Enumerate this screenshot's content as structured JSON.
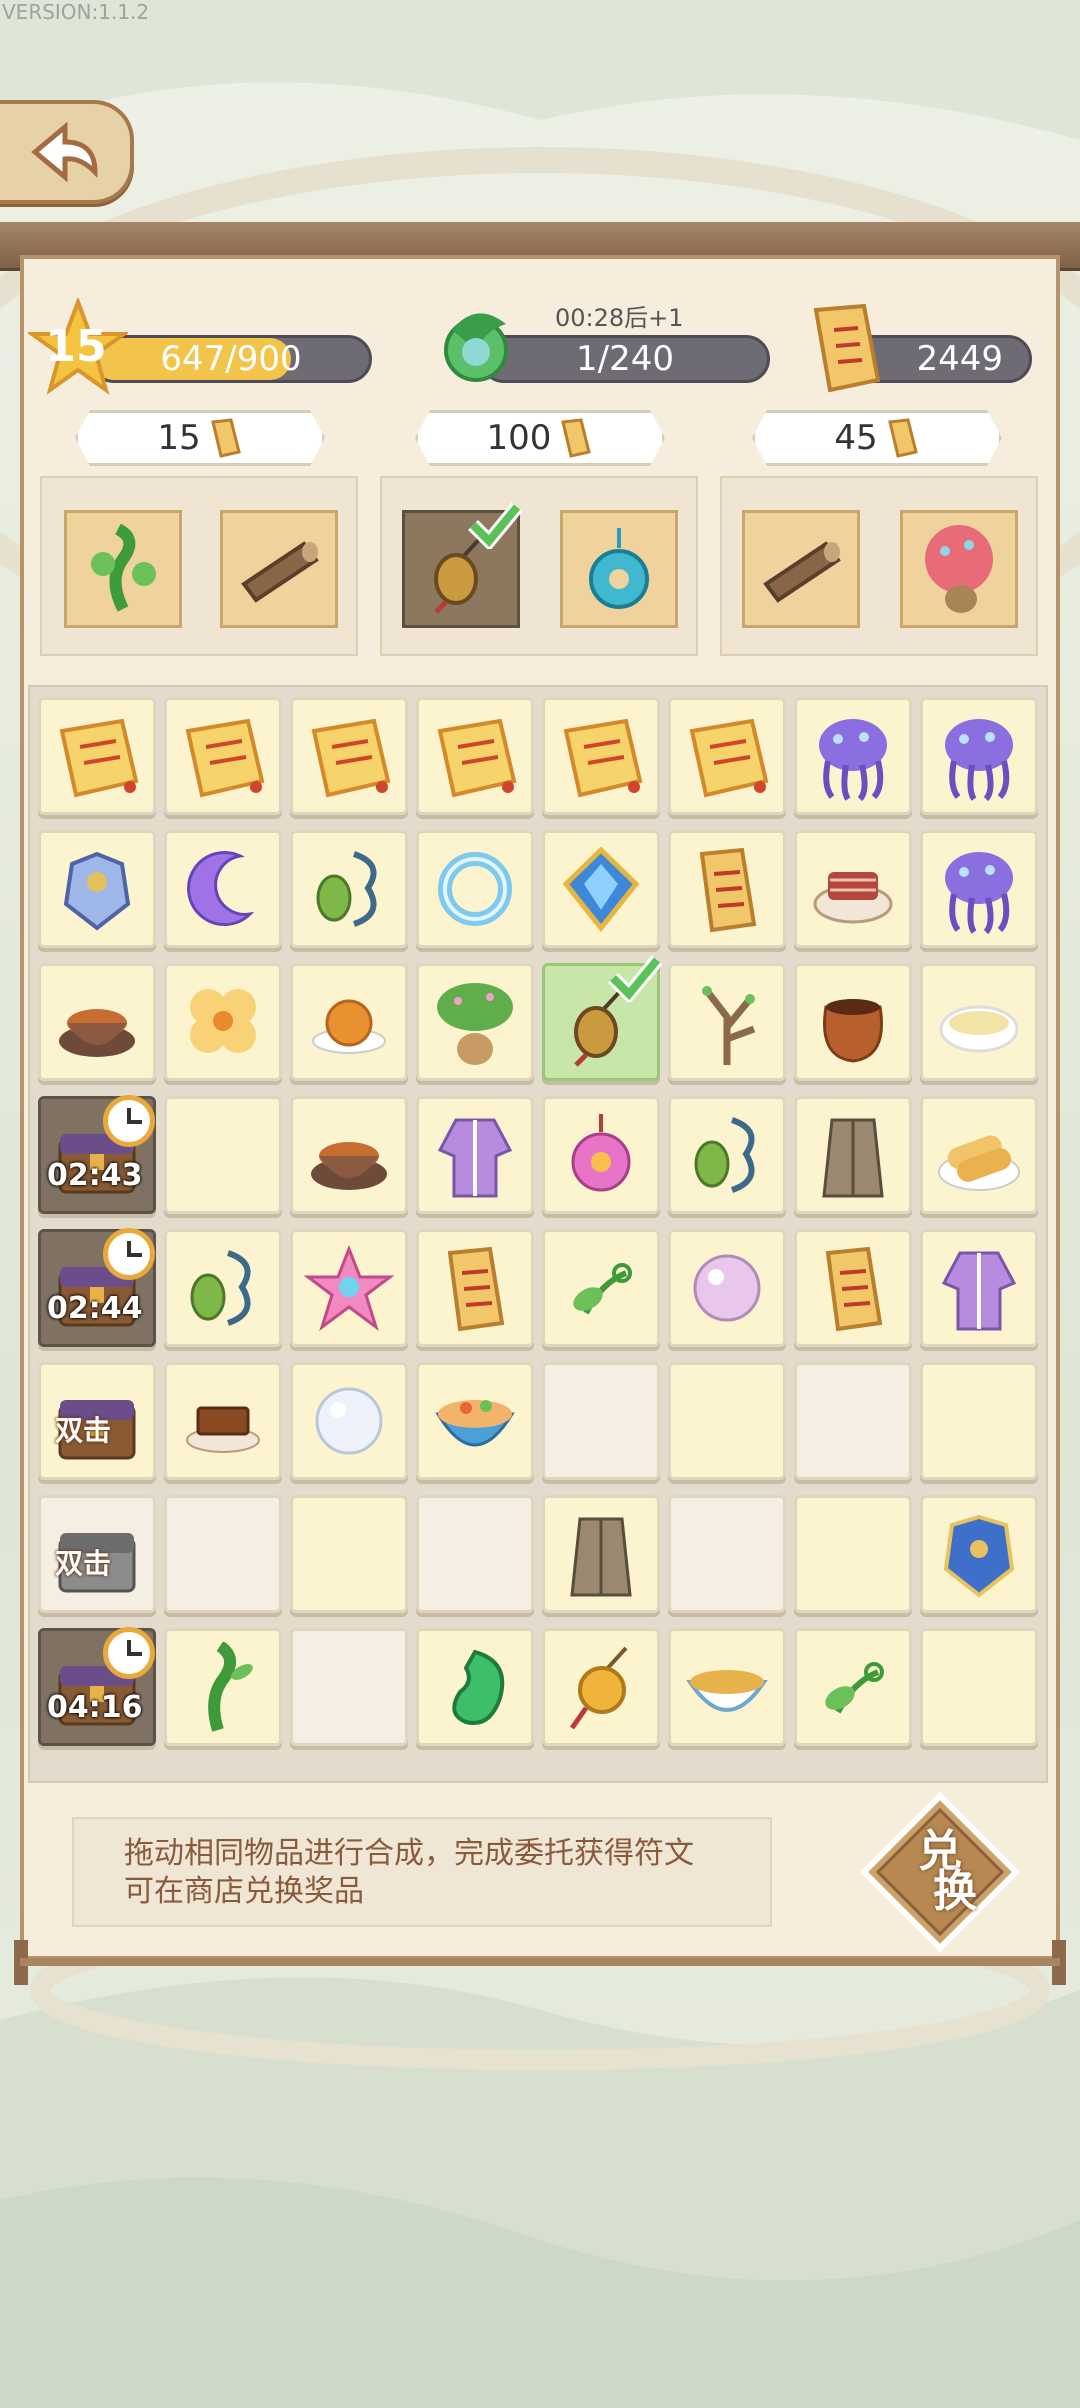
{
  "version": "VERSION:1.1.2",
  "header": {
    "level": "15",
    "xp_text": "647/900",
    "xp_progress": 0.719,
    "energy_timer": "00:28后+1",
    "energy_text": "1/240",
    "energy_progress": 0.004,
    "currency_amount": "2449"
  },
  "orders": [
    {
      "cost": "15",
      "items": [
        "vine-sprout",
        "wood-log"
      ]
    },
    {
      "cost": "100",
      "items": [
        "pouch-amulet",
        "jade-pendant"
      ]
    },
    {
      "cost": "45",
      "items": [
        "wood-log",
        "flower-tree"
      ]
    }
  ],
  "grid": [
    [
      "scroll",
      "scroll",
      "scroll",
      "scroll",
      "scroll",
      "scroll",
      "jellyfish",
      "jellyfish"
    ],
    [
      "armor",
      "moon",
      "bean-necklace",
      "water-ring",
      "blue-crystal",
      "talisman",
      "meat-platter",
      "jellyfish"
    ],
    [
      "soup-bowl",
      "yellow-flower",
      "mooncake",
      "bonsai-tree",
      "pouch-amulet",
      "branch",
      "clay-pot",
      "congee"
    ],
    [
      "chest-timer",
      "",
      "soup-bowl",
      "purple-robe",
      "pink-ornament",
      "bean-necklace",
      "leather-vest",
      "spring-rolls"
    ],
    [
      "chest-timer",
      "bean-necklace",
      "pink-flower",
      "talisman",
      "sprout",
      "pearl",
      "talisman",
      "purple-robe"
    ],
    [
      "double-chest",
      "chocolate",
      "white-pearl",
      "noodle-bowl",
      "",
      "",
      "",
      ""
    ],
    [
      "double-chest-gray",
      "",
      "",
      "",
      "leather-vest",
      "",
      "",
      "blue-armor"
    ],
    [
      "chest-timer",
      "vine",
      "",
      "green-jade",
      "gold-pendant",
      "soup-bowl-2",
      "sprout",
      ""
    ]
  ],
  "timers": {
    "r3": "02:43",
    "r4": "02:44",
    "r7": "04:16"
  },
  "badges": {
    "double": "双击"
  },
  "hint_text": "拖动相同物品进行合成，完成委托获得符文可在商店兑换奖品",
  "exchange_label_1": "兑",
  "exchange_label_2": "换"
}
